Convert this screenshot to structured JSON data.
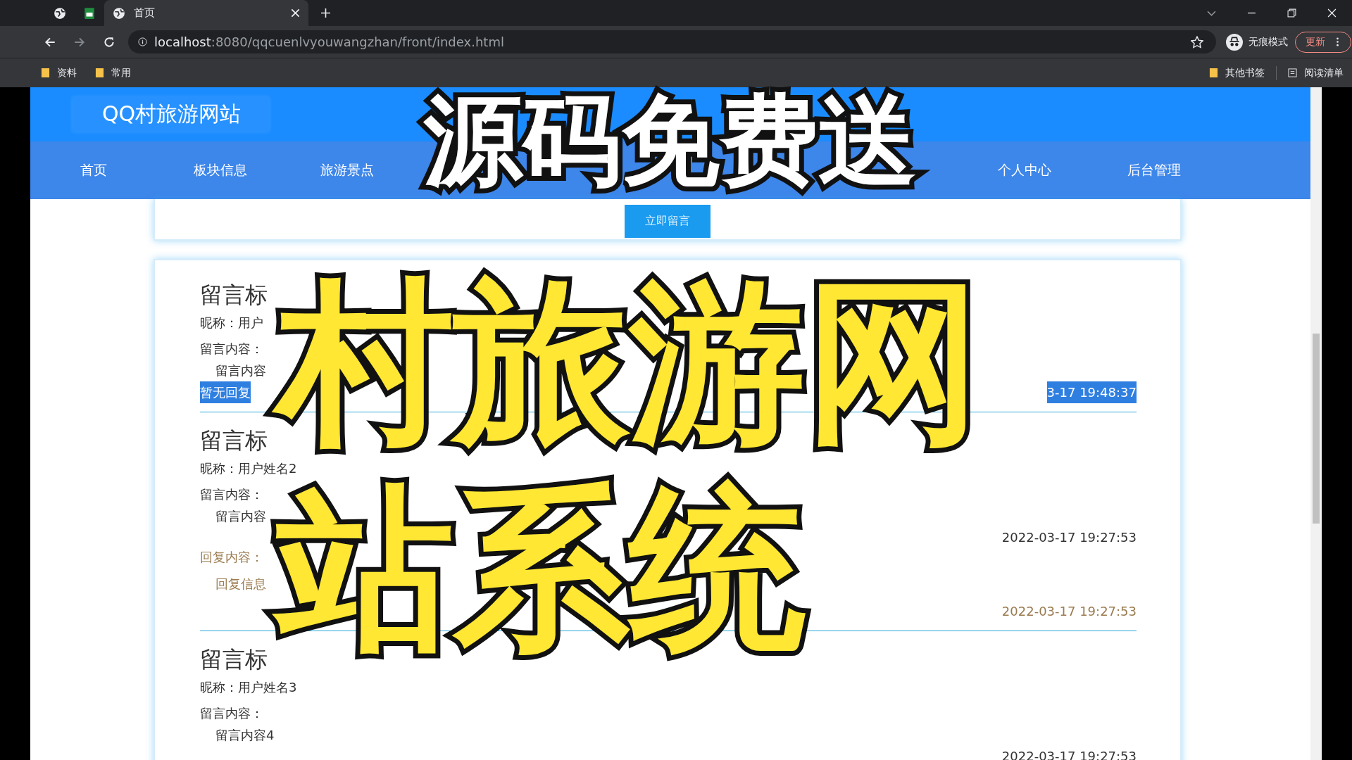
{
  "browser": {
    "tabs": [
      {
        "title": "首页",
        "selected": true
      }
    ],
    "url": {
      "host": "localhost",
      "path": ":8080/qqcuenlvyouwangzhan/front/index.html"
    },
    "profile_label": "无痕模式",
    "update_button": "更新",
    "bookmarks": [
      {
        "label": "资料"
      },
      {
        "label": "常用"
      }
    ],
    "other_bookmarks": "其他书签",
    "reading_list": "阅读清单"
  },
  "site": {
    "title": "QQ村旅游网站",
    "nav_left": [
      {
        "label": "首页"
      },
      {
        "label": "板块信息"
      },
      {
        "label": "旅游景点"
      }
    ],
    "nav_right": [
      {
        "label": "个人中心"
      },
      {
        "label": "后台管理"
      }
    ],
    "leave_message_button": "立即留言",
    "messages": [
      {
        "title": "留言标",
        "nickname": "昵称：用户",
        "content_label": "留言内容：",
        "content": "留言内容",
        "highlighted": true,
        "no_reply_text": "暂无回复",
        "time": "3-17 19:48:37"
      },
      {
        "title": "留言标",
        "nickname": "昵称：用户姓名2",
        "content_label": "留言内容：",
        "content": "留言内容",
        "highlighted": false,
        "time": "2022-03-17 19:27:53",
        "reply": {
          "label": "回复内容：",
          "text": "回复信息",
          "time": "2022-03-17 19:27:53"
        }
      },
      {
        "title": "留言标",
        "nickname": "昵称：用户姓名3",
        "content_label": "留言内容：",
        "content": "留言内容4",
        "highlighted": false,
        "time": "2022-03-17 19:27:53"
      }
    ]
  },
  "overlay": {
    "headline": "源码免费送",
    "title_lines": [
      "村旅游网",
      "站系统"
    ]
  }
}
